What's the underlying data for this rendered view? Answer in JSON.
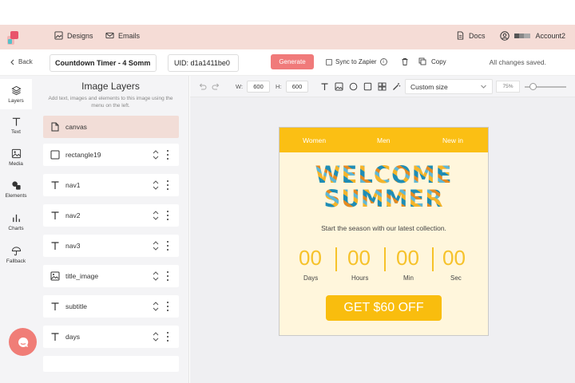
{
  "nav": {
    "designs": "Designs",
    "emails": "Emails",
    "docs": "Docs",
    "account": "Account2"
  },
  "toolbar": {
    "back": "Back",
    "template_name": "Countdown Timer - 4 Somm",
    "uid": "UID:  d1a1411be0",
    "generate": "Generate",
    "sync": "Sync to Zapier",
    "copy": "Copy",
    "status": "All changes saved."
  },
  "rail": [
    {
      "label": "Layers",
      "icon": "layers-icon"
    },
    {
      "label": "Text",
      "icon": "text-icon"
    },
    {
      "label": "Media",
      "icon": "image-icon"
    },
    {
      "label": "Elements",
      "icon": "shapes-icon"
    },
    {
      "label": "Charts",
      "icon": "chart-icon"
    },
    {
      "label": "Fallback",
      "icon": "umbrella-icon"
    }
  ],
  "layers": {
    "title": "Image Layers",
    "description": "Add text, images and elements to this image using the menu on the left.",
    "items": [
      {
        "name": "canvas",
        "icon": "page-icon"
      },
      {
        "name": "rectangle19",
        "icon": "square-icon"
      },
      {
        "name": "nav1",
        "icon": "text-icon"
      },
      {
        "name": "nav2",
        "icon": "text-icon"
      },
      {
        "name": "nav3",
        "icon": "text-icon"
      },
      {
        "name": "title_image",
        "icon": "image-icon"
      },
      {
        "name": "subtitle",
        "icon": "text-icon"
      },
      {
        "name": "days",
        "icon": "text-icon"
      }
    ]
  },
  "editor": {
    "w_label": "W:",
    "w_value": "600",
    "h_label": "H:",
    "h_value": "600",
    "size_select": "Custom size",
    "zoom": "75%",
    "zoom_level": 0.2
  },
  "email": {
    "nav": [
      "Women",
      "Men",
      "New in"
    ],
    "title_line1": "WELCOME",
    "title_line2": "SUMMER",
    "subtitle": "Start the season with our latest collection.",
    "timer": [
      {
        "value": "00",
        "unit": "Days"
      },
      {
        "value": "00",
        "unit": "Hours"
      },
      {
        "value": "00",
        "unit": "Min"
      },
      {
        "value": "00",
        "unit": "Sec"
      }
    ],
    "cta": "GET $60 OFF"
  },
  "colors": {
    "accent": "#f07a7a",
    "nav_bg": "#f5dcd6",
    "email_yellow": "#fbbf14",
    "email_bg": "#fff6dc"
  }
}
